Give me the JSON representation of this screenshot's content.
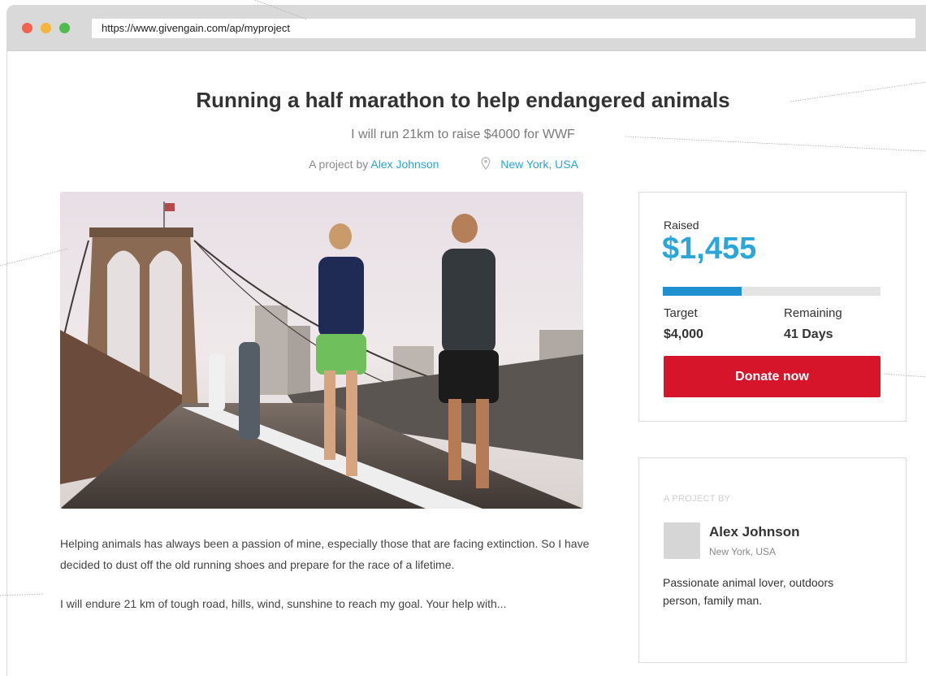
{
  "browser": {
    "url": "https://www.givengain.com/ap/myproject"
  },
  "project": {
    "title": "Running a half marathon to help endangered animals",
    "subtitle": "I will run 21km to raise $4000 for WWF",
    "byline_prefix": "A project by",
    "author_link": "Alex Johnson",
    "location": "New York, USA"
  },
  "donation": {
    "raised_label": "Raised",
    "raised_amount": "$1,455",
    "progress_fraction": 0.3638,
    "target_label": "Target",
    "target_value": "$4,000",
    "remaining_label": "Remaining",
    "remaining_value": "41 Days",
    "donate_label": "Donate now",
    "colors": {
      "accent": "#2aa6d8",
      "progress": "#1e90d0",
      "donate": "#d6152b"
    }
  },
  "description": {
    "paragraph1": "Helping animals has always been a passion of mine, especially those that are facing extinction. So I have decided to dust off the old running shoes and prepare for the race of a lifetime.",
    "paragraph2": "I will endure 21 km of tough road, hills, wind, sunshine to reach my goal. Your help with..."
  },
  "author": {
    "heading": "A PROJECT BY",
    "name": "Alex Johnson",
    "location": "New York, USA",
    "bio": "Passionate animal lover, outdoors person, family man."
  },
  "icons": {
    "location": "location-pin-icon"
  }
}
